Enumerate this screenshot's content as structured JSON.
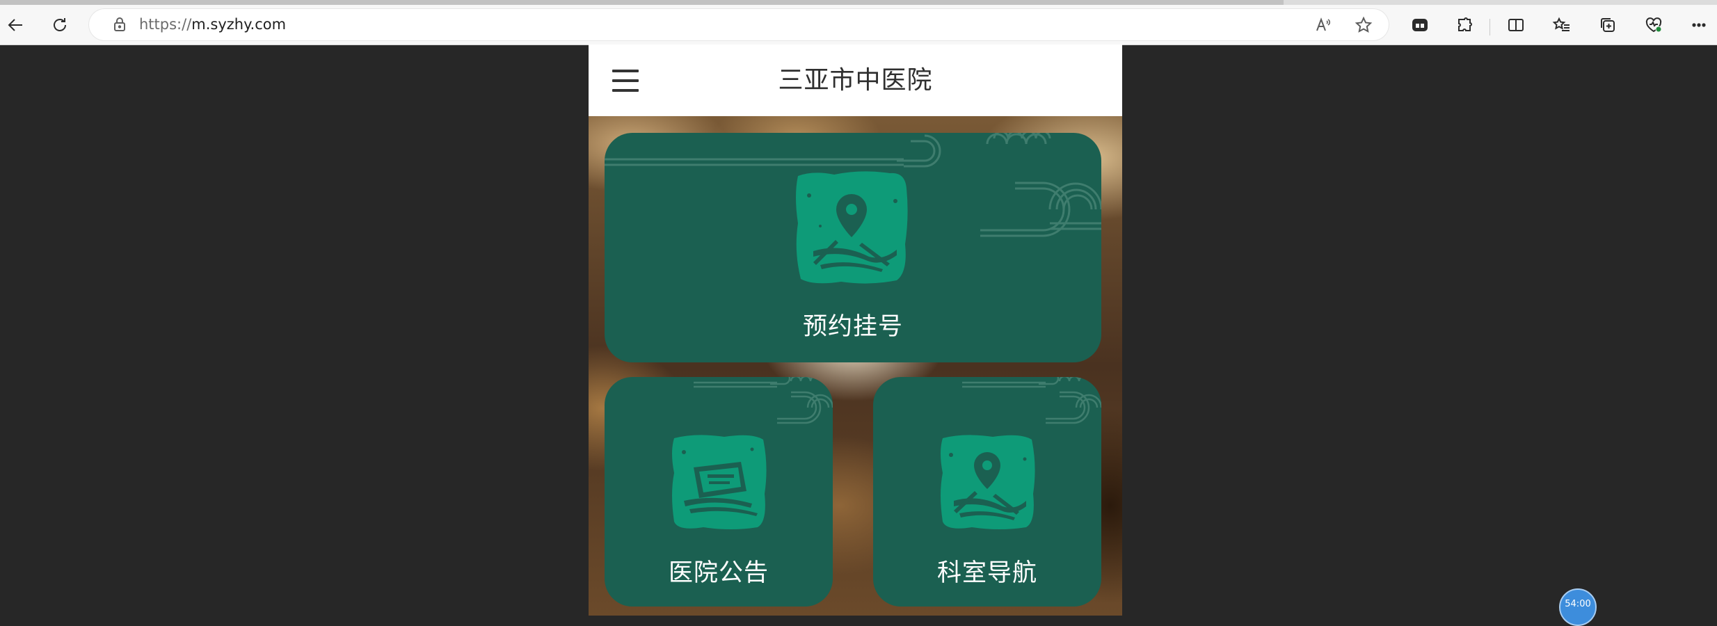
{
  "browser": {
    "url_protocol": "https://",
    "url_host": "m.syzhy.com",
    "icons": [
      "back-icon",
      "refresh-icon",
      "lock-icon",
      "read-aloud-icon",
      "favorite-star-icon",
      "tab-icon",
      "extensions-icon",
      "split-screen-icon",
      "favorites-icon",
      "collections-icon",
      "browser-essentials-icon",
      "more-icon"
    ]
  },
  "page": {
    "title": "三亚市中医院",
    "cards": [
      {
        "label": "预约挂号",
        "icon": "location-pin-icon"
      },
      {
        "label": "医院公告",
        "icon": "announcement-icon"
      },
      {
        "label": "科室导航",
        "icon": "location-pin-icon"
      }
    ]
  },
  "overlay": {
    "timer": "54:00"
  },
  "colors": {
    "card": "#1b6051",
    "emblem": "#0e9b78",
    "page_background": "#272727"
  }
}
